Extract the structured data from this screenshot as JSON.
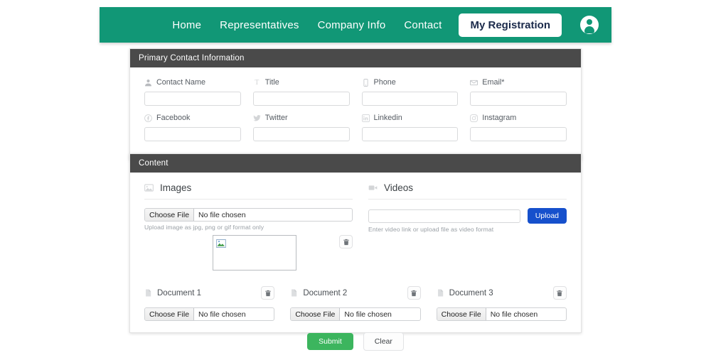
{
  "navbar": {
    "links": [
      {
        "label": "Home",
        "icon": ""
      },
      {
        "label": "Representatives",
        "icon": ""
      },
      {
        "label": "Company Info",
        "icon": ""
      },
      {
        "label": "Contact",
        "icon": ""
      }
    ],
    "active_button": "My Registration",
    "avatar_icon": "user-circle-icon",
    "background_color": "#119776",
    "button_text_color": "#1b2a4b"
  },
  "contact_section": {
    "header": "Primary Contact Information",
    "header_color": "#4a4a4a",
    "fields": [
      {
        "label": "Contact Name",
        "icon": "person-icon",
        "value": "",
        "placeholder": ""
      },
      {
        "label": "Title",
        "icon": "text-format-icon",
        "value": "",
        "placeholder": ""
      },
      {
        "label": "Phone",
        "icon": "mobile-phone-icon",
        "value": "",
        "placeholder": ""
      },
      {
        "label": "Email*",
        "icon": "envelope-icon",
        "value": "",
        "placeholder": ""
      },
      {
        "label": "Facebook",
        "icon": "facebook-icon",
        "value": "",
        "placeholder": ""
      },
      {
        "label": "Twitter",
        "icon": "twitter-icon",
        "value": "",
        "placeholder": ""
      },
      {
        "label": "Linkedin",
        "icon": "linkedin-icon",
        "value": "",
        "placeholder": ""
      },
      {
        "label": "Instagram",
        "icon": "instagram-icon",
        "value": "",
        "placeholder": ""
      }
    ]
  },
  "content_section": {
    "header": "Content",
    "images": {
      "title": "Images",
      "icon": "image-icon",
      "file_button_label": "Choose File",
      "file_status": "No file chosen",
      "hint": "Upload image as jpg, png or gif format only",
      "preview_icon": "broken-image-icon",
      "delete_icon": "trash-icon"
    },
    "videos": {
      "title": "Videos",
      "icon": "video-camera-icon",
      "input_value": "",
      "input_placeholder": "",
      "upload_label": "Upload",
      "upload_color": "#1650cc",
      "hint": "Enter video link or upload file as video format"
    },
    "documents": [
      {
        "label": "Document 1",
        "icon": "file-icon",
        "delete_icon": "trash-icon",
        "file_button_label": "Choose File",
        "file_status": "No file chosen"
      },
      {
        "label": "Document 2",
        "icon": "file-icon",
        "delete_icon": "trash-icon",
        "file_button_label": "Choose File",
        "file_status": "No file chosen"
      },
      {
        "label": "Document 3",
        "icon": "file-icon",
        "delete_icon": "trash-icon",
        "file_button_label": "Choose File",
        "file_status": "No file chosen"
      }
    ]
  },
  "footer": {
    "submit_label": "Submit",
    "submit_color": "#3cb55e",
    "clear_label": "Clear"
  }
}
